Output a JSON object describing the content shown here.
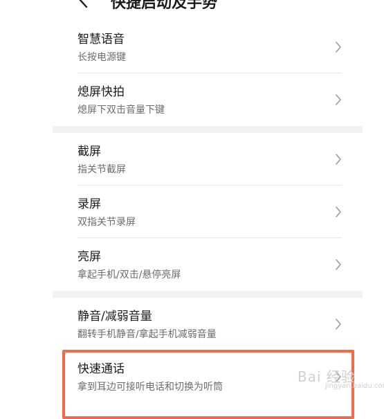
{
  "header": {
    "title": "快捷启动及手势",
    "back_icon": "back-arrow-icon"
  },
  "groups": [
    [
      {
        "title": "智慧语音",
        "subtitle": "长按电源键"
      },
      {
        "title": "熄屏快拍",
        "subtitle": "熄屏下双击音量下键"
      }
    ],
    [
      {
        "title": "截屏",
        "subtitle": "指关节截屏"
      },
      {
        "title": "录屏",
        "subtitle": "双指关节录屏"
      },
      {
        "title": "亮屏",
        "subtitle": "拿起手机/双击/悬停亮屏"
      }
    ],
    [
      {
        "title": "静音/减弱音量",
        "subtitle": "翻转手机静音/拿起手机减弱音量"
      },
      {
        "title": "快速通话",
        "subtitle": "拿到耳边可接听电话和切换为听筒"
      }
    ]
  ],
  "watermark": {
    "main": "Bai 经验",
    "sub": "jingyan.baidu.com"
  },
  "colors": {
    "highlight": "#f26a4a",
    "text": "#1a1a1a",
    "subtext": "#6b6b6b",
    "divider": "#e8e8e8",
    "group_gap": "#f2f2f2"
  }
}
